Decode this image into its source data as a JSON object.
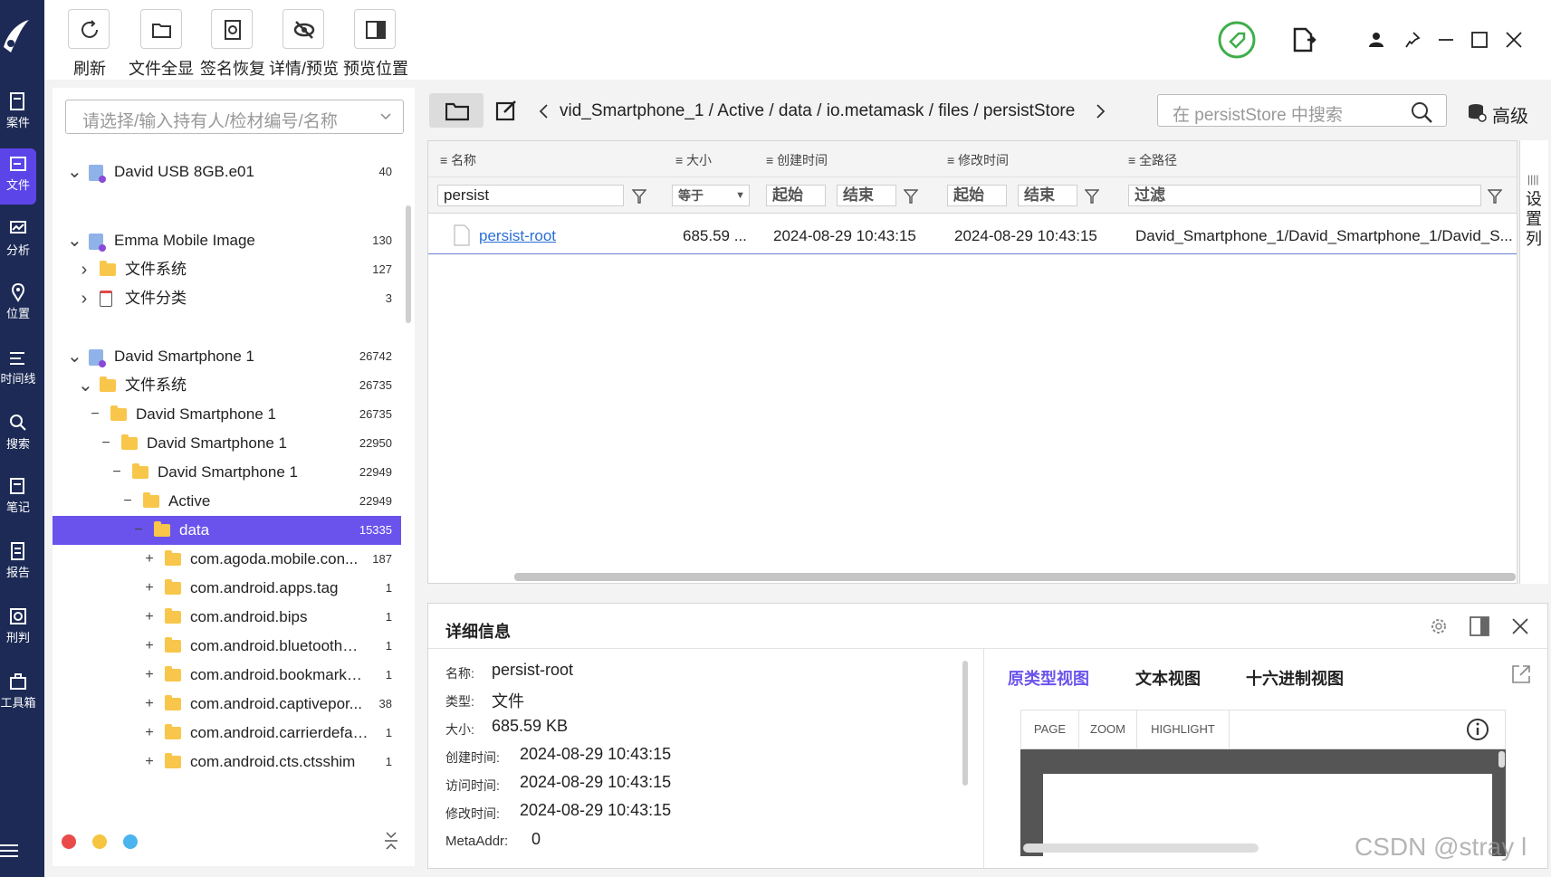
{
  "toolbar": {
    "refresh": "刷新",
    "show_all": "文件全显",
    "sig_restore": "签名恢复",
    "detail_preview": "详情/预览",
    "preview_pos": "预览位置"
  },
  "nav": {
    "items": [
      "案件",
      "文件",
      "分析",
      "位置",
      "时间线",
      "搜索",
      "笔记",
      "报告",
      "刑判",
      "工具箱"
    ]
  },
  "tree": {
    "select_placeholder": "请选择/输入持有人/检材编号/名称",
    "rows": [
      {
        "label": "David USB 8GB.e01",
        "count": "40"
      },
      {
        "label": "Emma Mobile Image",
        "count": "130"
      },
      {
        "label": "文件系统",
        "count": "127"
      },
      {
        "label": "文件分类",
        "count": "3"
      },
      {
        "label": "David Smartphone 1",
        "count": "26742"
      },
      {
        "label": "文件系统",
        "count": "26735"
      },
      {
        "label": "David Smartphone 1",
        "count": "26735"
      },
      {
        "label": "David Smartphone 1",
        "count": "22950"
      },
      {
        "label": "David Smartphone 1",
        "count": "22949"
      },
      {
        "label": "Active",
        "count": "22949"
      },
      {
        "label": "data",
        "count": "15335"
      },
      {
        "label": "com.agoda.mobile.con...",
        "count": "187"
      },
      {
        "label": "com.android.apps.tag",
        "count": "1"
      },
      {
        "label": "com.android.bips",
        "count": "1"
      },
      {
        "label": "com.android.bluetoothmi...",
        "count": "1"
      },
      {
        "label": "com.android.bookmarkpr...",
        "count": "1"
      },
      {
        "label": "com.android.captivepor...",
        "count": "38"
      },
      {
        "label": "com.android.carrierdefau...",
        "count": "1"
      },
      {
        "label": "com.android.cts.ctsshim",
        "count": "1"
      }
    ]
  },
  "breadcrumb": [
    "vid_Smartphone_1",
    "Active",
    "data",
    "io.metamask",
    "files",
    "persistStore"
  ],
  "search": {
    "placeholder": "在 persistStore 中搜索",
    "advanced": "高级"
  },
  "columns": {
    "name": "名称",
    "size": "大小",
    "created": "创建时间",
    "modified": "修改时间",
    "fullpath": "全路径"
  },
  "filters": {
    "name": "persist",
    "size_op": "等于",
    "start": "起始",
    "end": "结束",
    "start2": "起始",
    "end2": "结束",
    "path": "过滤"
  },
  "side_settings": "设置列",
  "file_row": {
    "name": "persist-root",
    "size": "685.59 ...",
    "created": "2024-08-29 10:43:15",
    "modified": "2024-08-29 10:43:15",
    "path": "David_Smartphone_1/David_Smartphone_1/David_S..."
  },
  "details": {
    "title": "详细信息",
    "name_k": "名称:",
    "name_v": "persist-root",
    "type_k": "类型:",
    "type_v": "文件",
    "size_k": "大小:",
    "size_v": "685.59 KB",
    "ctime_k": "创建时间:",
    "ctime_v": "2024-08-29 10:43:15",
    "atime_k": "访问时间:",
    "atime_v": "2024-08-29 10:43:15",
    "mtime_k": "修改时间:",
    "mtime_v": "2024-08-29 10:43:15",
    "meta_k": "MetaAddr:",
    "meta_v": "0"
  },
  "views": {
    "raw": "原类型视图",
    "text": "文本视图",
    "hex": "十六进制视图"
  },
  "pdf_toolbar": {
    "page": "PAGE",
    "zoom": "ZOOM",
    "highlight": "HIGHLIGHT"
  },
  "watermark": "CSDN @stray l",
  "colors": {
    "nav_bg": "#1c2a55",
    "accent": "#6a53ec",
    "link": "#2a6fd6"
  }
}
